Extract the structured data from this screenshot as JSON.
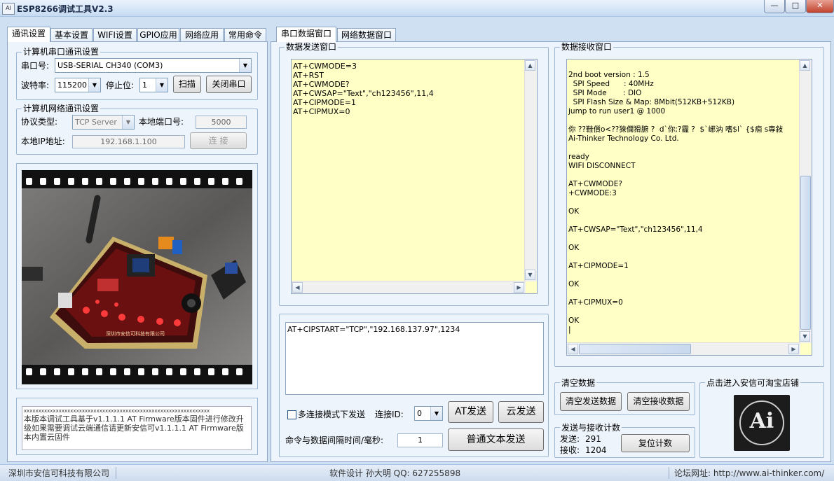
{
  "window": {
    "title": "ESP8266调试工具V2.3",
    "app_icon": "AI"
  },
  "window_controls": {
    "minimize": "—",
    "maximize": "□",
    "close": "✕"
  },
  "left_tabs": [
    "通讯设置",
    "基本设置",
    "WIFI设置",
    "GPIO应用",
    "网络应用",
    "常用命令"
  ],
  "serial": {
    "group_title": "计算机串口通讯设置",
    "port_label": "串口号:",
    "port_value": "USB-SERIAL CH340 (COM3)",
    "baud_label": "波特率:",
    "baud_value": "115200",
    "stopbit_label": "停止位:",
    "stopbit_value": "1",
    "scan_button": "扫描",
    "close_button": "关闭串口"
  },
  "network": {
    "group_title": "计算机网络通讯设置",
    "protocol_label": "协议类型:",
    "protocol_value": "TCP Server",
    "local_port_label": "本地端口号:",
    "local_port_value": "5000",
    "local_ip_label": "本地IP地址:",
    "local_ip_value": "192.168.1.100",
    "connect_button": "连 接"
  },
  "photo": {
    "board_label": "深圳市安信可科技有限公司"
  },
  "notice": {
    "dashes": "xxxxxxxxxxxxxxxxxxxxxxxxxxxxxxxxxxxxxxxxxxxxxxxxxxxxxxxxxxxxxxxx",
    "text": "本版本调试工具基于v1.1.1.1 AT Firmware版本固件进行修改升级如果需要调试云端通信请更新安信可v1.1.1.1 AT Firmware版本内置云固件"
  },
  "right_tabs": [
    "串口数据窗口",
    "网络数据窗口"
  ],
  "send_window": {
    "title": "数据发送窗口",
    "content": "AT+CWMODE=3\nAT+RST\nAT+CWMODE?\nAT+CWSAP=\"Text\",\"ch123456\",11,4\nAT+CIPMODE=1\nAT+CIPMUX=0"
  },
  "command_input": {
    "value": "AT+CIPSTART=\"TCP\",\"192.168.137.97\",1234"
  },
  "send_controls": {
    "multi_conn_label": "多连接模式下发送",
    "conn_id_label": "连接ID:",
    "conn_id_value": "0",
    "at_send_button": "AT发送",
    "cloud_send_button": "云发送",
    "interval_label": "命令与数据间隔时间/毫秒:",
    "interval_value": "1",
    "text_send_button": "普通文本发送"
  },
  "receive_window": {
    "title": "数据接收窗口",
    "content": "2nd boot version : 1.5\n  SPI Speed      : 40MHz\n  SPI Mode       : DIO\n  SPI Flash Size & Map: 8Mbit(512KB+512KB)\njump to run user1 @ 1000\n\n你 ??鞋儨o<??猍儞猾腑 ?  d`你;?霾 ?  $`峫汭 嗜$l` {$痐 s專敍\nAi-Thinker Technology Co. Ltd.\n\nready\nWIFI DISCONNECT\n\nAT+CWMODE?\n+CWMODE:3\n\nOK\n\nAT+CWSAP=\"Text\",\"ch123456\",11,4\n\nOK\n\nAT+CIPMODE=1\n\nOK\n\nAT+CIPMUX=0\n\nOK\n|"
  },
  "clear": {
    "group_title": "清空数据",
    "clear_send": "清空发送数据",
    "clear_recv": "清空接收数据"
  },
  "counter": {
    "group_title": "发送与接收计数",
    "sent_label": "发送:",
    "sent_value": "291",
    "recv_label": "接收:",
    "recv_value": "1204",
    "reset_button": "复位计数"
  },
  "shop": {
    "group_title": "点击进入安信可淘宝店铺",
    "logo_text": "Ai"
  },
  "status": {
    "company": "深圳市安信可科技有限公司",
    "design": "软件设计 孙大明 QQ: 627255898",
    "forum": "论坛网址: http://www.ai-thinker.com/"
  }
}
